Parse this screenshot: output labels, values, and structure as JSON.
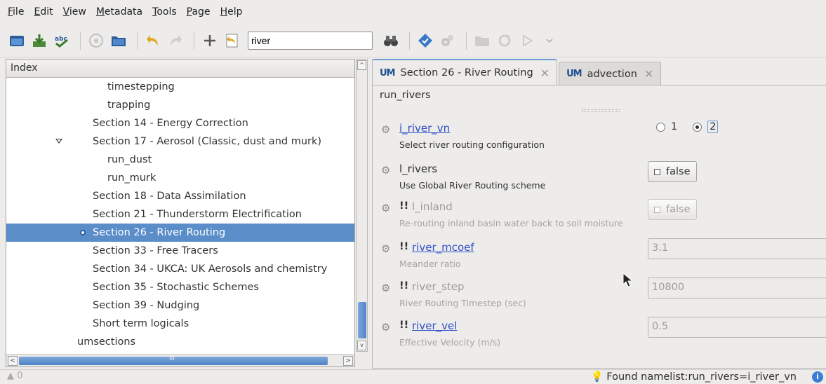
{
  "menubar": [
    {
      "ul": "F",
      "rest": "ile"
    },
    {
      "ul": "E",
      "rest": "dit"
    },
    {
      "ul": "V",
      "rest": "iew"
    },
    {
      "ul": "M",
      "rest": "etadata"
    },
    {
      "ul": "T",
      "rest": "ools"
    },
    {
      "ul": "P",
      "rest": "age"
    },
    {
      "ul": "H",
      "rest": "elp"
    }
  ],
  "toolbar": {
    "search_value": "river"
  },
  "index": {
    "header": "Index",
    "rows": [
      {
        "label": "timestepping"
      },
      {
        "label": "trapping"
      },
      {
        "label": "Section 14 - Energy Correction"
      },
      {
        "label": "Section 17 - Aerosol (Classic, dust and murk)"
      },
      {
        "label": "run_dust"
      },
      {
        "label": "run_murk"
      },
      {
        "label": "Section 18 - Data Assimilation"
      },
      {
        "label": "Section 21 - Thunderstorm Electrification"
      },
      {
        "label": "Section 26 - River Routing"
      },
      {
        "label": "Section 33 - Free Tracers"
      },
      {
        "label": "Section 34 - UKCA: UK Aerosols and chemistry"
      },
      {
        "label": "Section 35 - Stochastic Schemes"
      },
      {
        "label": "Section 39 - Nudging"
      },
      {
        "label": "Short term logicals"
      },
      {
        "label": "umsections"
      }
    ],
    "hscroll_mid": "III"
  },
  "tabs": [
    {
      "icon": "UM",
      "label": "Section 26 - River Routing"
    },
    {
      "icon": "UM",
      "label": "advection"
    }
  ],
  "panel": {
    "namelist": "run_rivers",
    "vars": [
      {
        "name": "i_river_vn",
        "bang": "",
        "desc": "Select river routing configuration",
        "radio_1": "1",
        "radio_2": "2"
      },
      {
        "name": "l_rivers",
        "bang": "",
        "desc": "Use Global River Routing scheme",
        "value": "false"
      },
      {
        "name": "l_inland",
        "bang": "!!",
        "desc": "Re-routing inland basin water back to soil moisture",
        "value": "false"
      },
      {
        "name": "river_mcoef",
        "bang": "!!",
        "desc": "Meander ratio",
        "value": "3.1"
      },
      {
        "name": "river_step",
        "bang": "!!",
        "desc": "River Routing Timestep (sec)",
        "value": "10800"
      },
      {
        "name": "river_vel",
        "bang": "!!",
        "desc": "Effective Velocity (m/s)",
        "value": "0.5"
      }
    ]
  },
  "status": {
    "left": "0",
    "message": "Found namelist:run_rivers=i_river_vn",
    "info": "i"
  },
  "colors": {
    "selection": "#5b8dc9",
    "link": "#2d4fc8"
  }
}
